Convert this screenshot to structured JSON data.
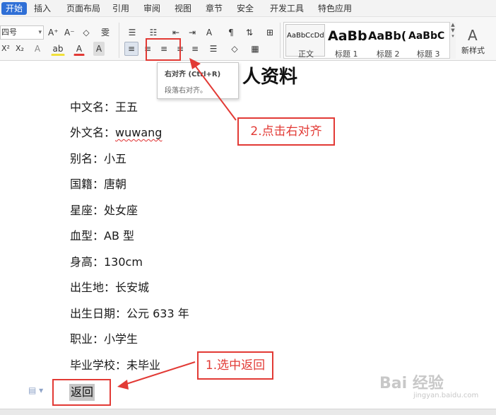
{
  "menu": {
    "tabs": [
      "开始",
      "插入",
      "页面布局",
      "引用",
      "审阅",
      "视图",
      "章节",
      "安全",
      "开发工具",
      "特色应用"
    ],
    "active_index": 0
  },
  "ribbon": {
    "font_size": "四号",
    "font_size_dropdown": "▾",
    "grow_font": "A⁺",
    "shrink_font": "A⁻",
    "clear_format": "◇",
    "phonetic": "雯",
    "superscript": "X²",
    "subscript": "X₂",
    "text_effect": "A",
    "highlight": "ab",
    "font_color": "A",
    "char_shading": "A",
    "bullet_list": "☰",
    "numbered_list": "☷",
    "decrease_indent": "⇤",
    "increase_indent": "⇥",
    "chinese_layout": "A",
    "show_hide": "¶",
    "line_spacing_dd": "⇅",
    "table_icon": "⊞",
    "align_left": "≡",
    "align_center": "≡",
    "align_right": "≡",
    "justify": "≡",
    "distributed": "≡",
    "paragraph_spacing": "☰",
    "shading": "◇",
    "borders": "▦",
    "styles": [
      {
        "sample": "AaBbCcDd",
        "name": "正文"
      },
      {
        "sample": "AaBb",
        "name": "标题 1"
      },
      {
        "sample": "AaBb(",
        "name": "标题 2"
      },
      {
        "sample": "AaBbC",
        "name": "标题 3"
      }
    ],
    "new_style_label": "新样式",
    "new_style_icon": "A"
  },
  "tooltip": {
    "title": "右对齐 (Ctrl+R)",
    "description": "段落右对齐。"
  },
  "document": {
    "title": "人资料",
    "lines": [
      "中文名：王五",
      "外文名：wuwang",
      "别名：小五",
      "国籍：唐朝",
      "星座：处女座",
      "血型：AB 型",
      "身高：130cm",
      "出生地：长安城",
      "出生日期：公元 633 年",
      "职业：小学生",
      "毕业学校：未毕业"
    ],
    "en_name_label": "外文名：",
    "en_name_value": "wuwang",
    "selected_text": "返回"
  },
  "annotations": {
    "step1": "1.选中返回",
    "step2": "2.点击右对齐",
    "color": "#e23a35"
  },
  "watermark": {
    "main": "Bai 经验",
    "sub": "jingyan.baidu.com"
  }
}
